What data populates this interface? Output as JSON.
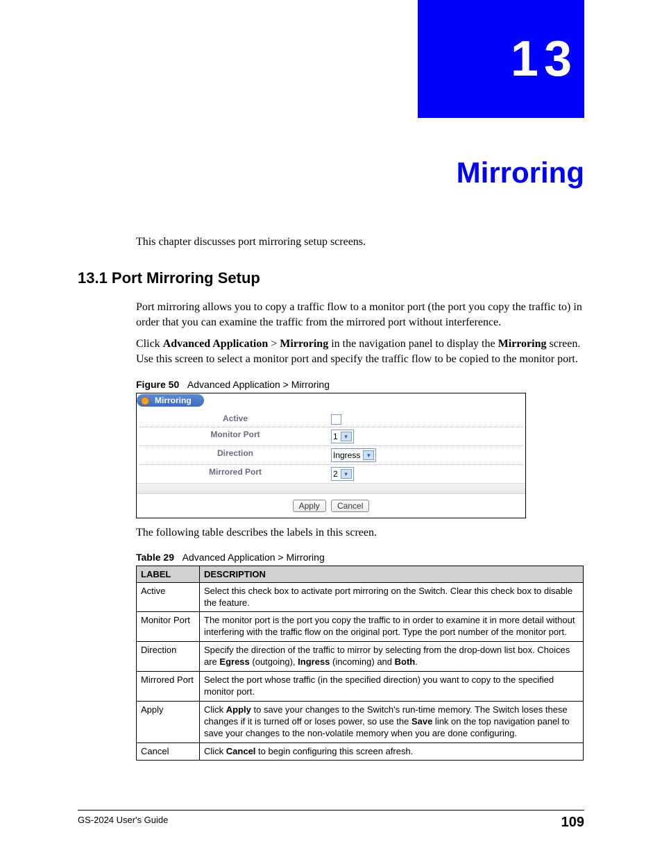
{
  "chapter": {
    "number": "13",
    "title": "Mirroring"
  },
  "intro": "This chapter discusses port mirroring setup screens.",
  "section": {
    "heading": "13.1  Port Mirroring Setup",
    "p1": "Port mirroring allows you to copy a traffic flow to a monitor port (the port you copy the traffic to) in order that you can examine the traffic from the mirrored port without interference.",
    "p2_pre": "Click ",
    "p2_b1": "Advanced Application",
    "p2_sep": " > ",
    "p2_b2": "Mirroring",
    "p2_mid": " in the navigation panel to display the ",
    "p2_b3": "Mirroring",
    "p2_post": " screen. Use this screen to select a monitor port and specify the traffic flow to be copied to the monitor port."
  },
  "figure": {
    "caption_label": "Figure 50",
    "caption_text": "Advanced Application > Mirroring",
    "tab": "Mirroring",
    "rows": {
      "active": "Active",
      "monitor_port": "Monitor Port",
      "monitor_port_val": "1",
      "direction": "Direction",
      "direction_val": "Ingress",
      "mirrored_port": "Mirrored Port",
      "mirrored_port_val": "2"
    },
    "apply": "Apply",
    "cancel": "Cancel"
  },
  "after_figure": "The following table describes the labels in this screen.",
  "table": {
    "caption_label": "Table 29",
    "caption_text": "Advanced Application > Mirroring",
    "head_label": "LABEL",
    "head_desc": "DESCRIPTION",
    "rows": [
      {
        "label": "Active",
        "desc": "Select this check box to activate port mirroring on the Switch. Clear this check box to disable the feature."
      },
      {
        "label": "Monitor Port",
        "desc": "The monitor port is the port you copy the traffic to in order to examine it in more detail without interfering with the traffic flow on the original port. Type the port number of the monitor port."
      },
      {
        "label": "Direction",
        "desc_pre": "Specify the direction of the traffic to mirror by selecting from the drop-down list box. Choices are ",
        "b1": "Egress",
        "mid1": " (outgoing), ",
        "b2": "Ingress",
        "mid2": " (incoming) and ",
        "b3": "Both",
        "post": "."
      },
      {
        "label": "Mirrored Port",
        "desc": "Select the port whose traffic (in the specified direction) you want to copy to the specified monitor port."
      },
      {
        "label": "Apply",
        "desc_pre": "Click ",
        "b1": "Apply",
        "mid1": " to save your changes to the Switch's run-time memory. The Switch loses these changes if it is turned off or loses power, so use the ",
        "b2": "Save",
        "post": " link on the top navigation panel to save your changes to the non-volatile memory when you are done configuring."
      },
      {
        "label": "Cancel",
        "desc_pre": "Click ",
        "b1": "Cancel",
        "post": " to begin configuring this screen afresh."
      }
    ]
  },
  "footer": {
    "left": "GS-2024 User's Guide",
    "page": "109"
  }
}
